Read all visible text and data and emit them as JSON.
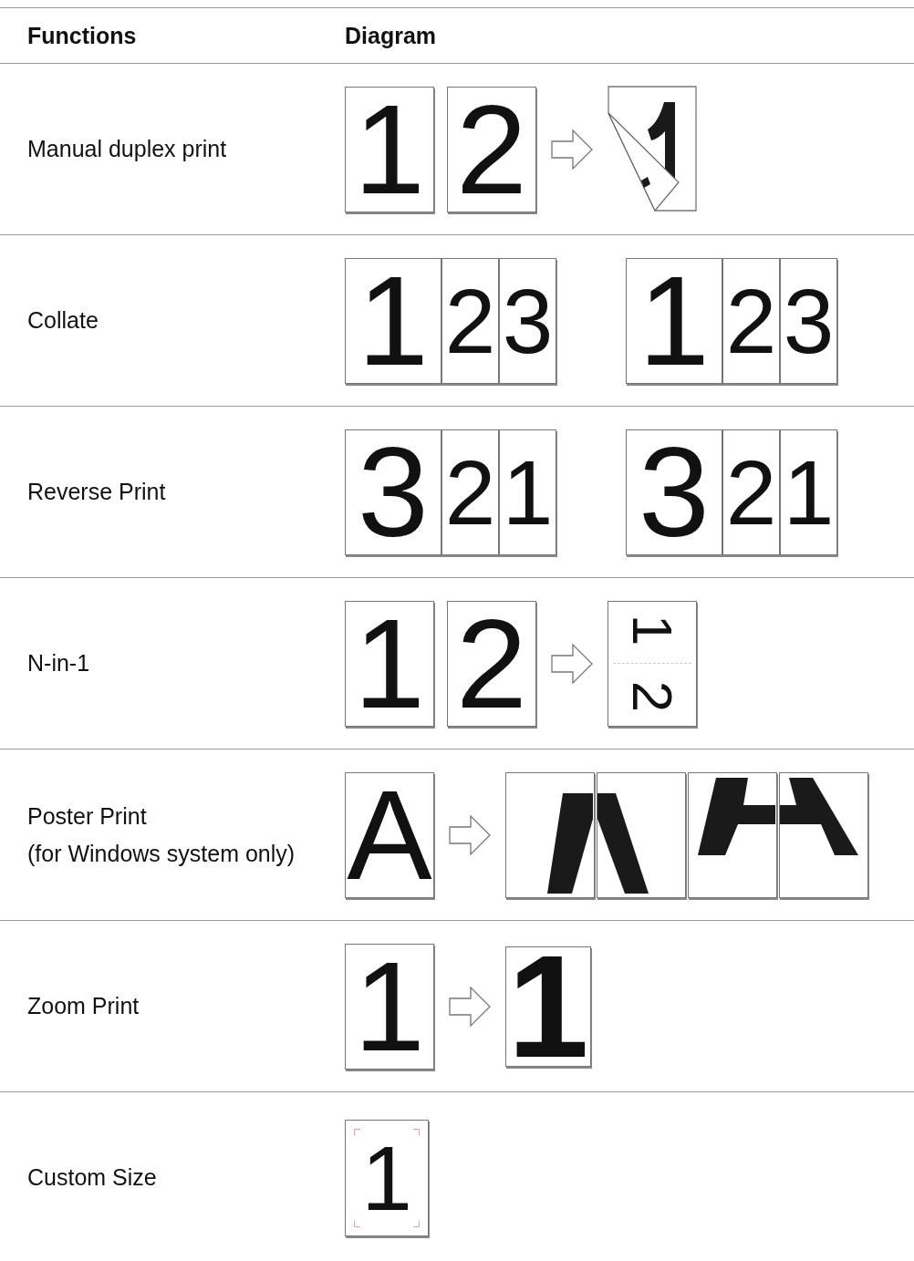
{
  "table": {
    "columns": [
      "Functions",
      "Diagram"
    ],
    "rows": [
      {
        "function": [
          "Manual duplex print"
        ],
        "diagram": [
          {
            "kind": "page",
            "text": "1"
          },
          {
            "kind": "page",
            "text": "2"
          },
          {
            "kind": "arrow"
          },
          {
            "kind": "curled_page"
          }
        ]
      },
      {
        "function": [
          "Collate"
        ],
        "diagram": [
          {
            "kind": "stack",
            "pages": [
              "1",
              "2",
              "3"
            ]
          },
          {
            "kind": "stack",
            "pages": [
              "1",
              "2",
              "3"
            ]
          }
        ]
      },
      {
        "function": [
          "Reverse Print"
        ],
        "diagram": [
          {
            "kind": "stack",
            "pages": [
              "3",
              "2",
              "1"
            ]
          },
          {
            "kind": "stack",
            "pages": [
              "3",
              "2",
              "1"
            ]
          }
        ]
      },
      {
        "function": [
          "N-in-1"
        ],
        "diagram": [
          {
            "kind": "page",
            "text": "1"
          },
          {
            "kind": "page",
            "text": "2"
          },
          {
            "kind": "arrow"
          },
          {
            "kind": "split_page",
            "texts": [
              "1",
              "2"
            ]
          }
        ]
      },
      {
        "function": [
          "Poster Print",
          "(for Windows system only)"
        ],
        "diagram": [
          {
            "kind": "page",
            "text": "A"
          },
          {
            "kind": "arrow"
          },
          {
            "kind": "poster_bottom_left"
          },
          {
            "kind": "poster_bottom_right"
          },
          {
            "kind": "poster_top_left"
          },
          {
            "kind": "poster_top_right"
          }
        ]
      },
      {
        "function": [
          "Zoom Print"
        ],
        "diagram": [
          {
            "kind": "page",
            "text": "1"
          },
          {
            "kind": "arrow"
          },
          {
            "kind": "zoomed_page",
            "text": "1"
          }
        ]
      },
      {
        "function": [
          "Custom Size"
        ],
        "diagram": [
          {
            "kind": "page",
            "text": "1",
            "crop_marks": true
          }
        ]
      }
    ]
  }
}
